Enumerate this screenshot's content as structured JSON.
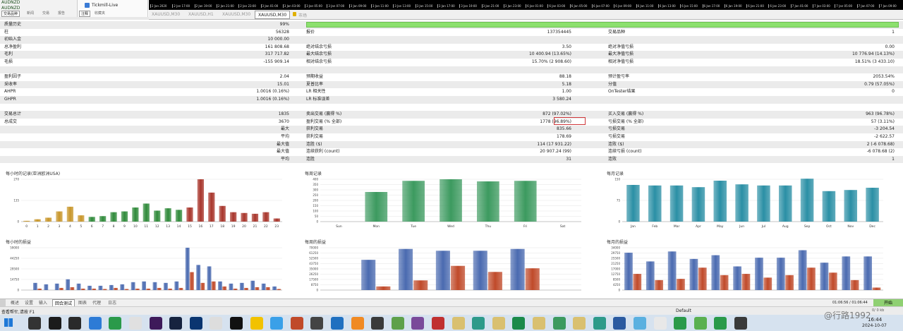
{
  "nav": {
    "account_a": "AUDNZD",
    "account_b": "AUDNZD",
    "tab_history": "交易品种",
    "tab_news": "新闻",
    "tab_trade": "交易",
    "tab_report": "报告",
    "broker": "Tickmill-Live",
    "tab_note": "注释",
    "tab_fav": "收藏夹"
  },
  "time_axis": [
    "2 Jan 2020",
    "2 Jan 17:00",
    "2 Jan 19:00",
    "2 Jan 21:00",
    "2 Jan 23:00",
    "3 Jan 01:00",
    "3 Jan 03:00",
    "3 Jan 05:00",
    "3 Jan 07:00",
    "3 Jan 09:00",
    "3 Jan 11:00",
    "3 Jan 13:00",
    "3 Jan 15:00",
    "3 Jan 17:00",
    "3 Jan 19:00",
    "3 Jan 21:00",
    "3 Jan 23:00",
    "6 Jan 01:00",
    "6 Jan 03:00",
    "6 Jan 05:00",
    "6 Jan 07:00",
    "6 Jan 09:00",
    "6 Jan 11:00",
    "6 Jan 13:00",
    "6 Jan 15:00",
    "6 Jan 17:00",
    "6 Jan 19:00",
    "6 Jan 21:00",
    "6 Jan 23:00",
    "7 Jan 01:00",
    "7 Jan 03:00",
    "7 Jan 05:00",
    "7 Jan 07:00",
    "7 Jan 09:00"
  ],
  "chart_tabs": [
    "XAUUSD,M30",
    "XAUUSD,H1",
    "XAUUSD,M30",
    "XAUUSD,M30"
  ],
  "market_tab": "市场",
  "report": {
    "rows": [
      {
        "l1": "质量历史",
        "v1": "99%",
        "l2": "",
        "v2": "",
        "l3": "",
        "v3": ""
      },
      {
        "l1": "柱",
        "v1": "56328",
        "l2": "报价",
        "v2": "137354445",
        "l3": "交易品种",
        "v3": "1"
      },
      {
        "l1": "初始入金",
        "v1": "10 000.00",
        "l2": "",
        "v2": "",
        "l3": "",
        "v3": ""
      },
      {
        "l1": "总净盈利",
        "v1": "161 808.68",
        "l2": "绝对结余亏损",
        "v2": "3.50",
        "l3": "绝对净值亏损",
        "v3": "0.00"
      },
      {
        "l1": "毛利",
        "v1": "317 717.82",
        "l2": "最大结余亏损",
        "v2": "10 400.94 (13.65%)",
        "l3": "最大净值亏损",
        "v3": "10 776.94 (14.13%)"
      },
      {
        "l1": "毛损",
        "v1": "-155 909.14",
        "l2": "相对结余亏损",
        "v2": "15.70% (2 908.60)",
        "l3": "相对净值亏损",
        "v3": "18.51% (3 433.10)"
      },
      {
        "l1": "",
        "v1": "",
        "l2": "",
        "v2": "",
        "l3": "",
        "v3": ""
      },
      {
        "l1": "盈利因子",
        "v1": "2.04",
        "l2": "预期收益",
        "v2": "88.18",
        "l3": "预计盈亏率",
        "v3": "2053.54%"
      },
      {
        "l1": "采收率",
        "v1": "15.01",
        "l2": "夏普比率",
        "v2": "5.18",
        "l3": "分值",
        "v3": "0.79 (57.05%)"
      },
      {
        "l1": "AHPR",
        "v1": "1.0016 (0.16%)",
        "l2": "LR 相关性",
        "v2": "1.00",
        "l3": "OnTester结果",
        "v3": "0"
      },
      {
        "l1": "GHPR",
        "v1": "1.0016 (0.16%)",
        "l2": "LR 标准误差",
        "v2": "3 580.24",
        "l3": "",
        "v3": ""
      },
      {
        "l1": "",
        "v1": "",
        "l2": "",
        "v2": "",
        "l3": "",
        "v3": ""
      },
      {
        "l1": "交易总计",
        "v1": "1835",
        "l2": "卖出交易 (赢得 %)",
        "v2": "872 (97.02%)",
        "l3": "买入交易 (赢得 %)",
        "v3": "963 (96.78%)"
      },
      {
        "l1": "总成交",
        "v1": "3670",
        "l2": "盈利交易 (% 全部)",
        "v2": "1778 (96.89%)",
        "l3": "亏损交易 (% 全部)",
        "v3": "57 (3.11%)"
      },
      {
        "l1": "最大",
        "v1": "",
        "l2": "获利交易",
        "v2": "835.66",
        "l3": "亏损交易",
        "v3": "-3 204.54"
      },
      {
        "l1": "平均",
        "v1": "",
        "l2": "获利交易",
        "v2": "178.69",
        "l3": "亏损交易",
        "v3": "-2 622.57"
      },
      {
        "l1": "最大值",
        "v1": "",
        "l2": "连胜 ($)",
        "v2": "114 (17 931.22)",
        "l3": "连败 ($)",
        "v3": "2 (-6 078.68)"
      },
      {
        "l1": "最大值",
        "v1": "",
        "l2": "连续获利 (count)",
        "v2": "20 907.24 (99)",
        "l3": "连续亏损 (count)",
        "v3": "-6 078.68 (2)"
      },
      {
        "l1": "平均",
        "v1": "",
        "l2": "连胜",
        "v2": "31",
        "l3": "连败",
        "v3": "1"
      }
    ]
  },
  "charts": {
    "hourly_title": "每小时的记录(亚洲欧洲USA)",
    "weekly_title": "每周记录",
    "monthly_title": "每月记录",
    "hourly_pl_title": "每小时的损益",
    "weekly_pl_title": "每周的损益",
    "monthly_pl_title": "每月的损益"
  },
  "chart_data": [
    {
      "type": "bar",
      "title": "每小时的记录(亚洲欧洲USA)",
      "categories": [
        "0",
        "1",
        "2",
        "3",
        "4",
        "5",
        "6",
        "7",
        "8",
        "9",
        "10",
        "11",
        "12",
        "13",
        "14",
        "15",
        "16",
        "17",
        "18",
        "19",
        "20",
        "21",
        "22",
        "23"
      ],
      "values": [
        5,
        15,
        25,
        65,
        95,
        40,
        30,
        35,
        60,
        65,
        90,
        115,
        70,
        85,
        75,
        90,
        270,
        185,
        100,
        60,
        55,
        50,
        60,
        20
      ],
      "ylim": [
        0,
        270
      ],
      "yticks": [
        "0",
        "135",
        "270"
      ]
    },
    {
      "type": "bar",
      "title": "每周记录",
      "categories": [
        "Sun",
        "Mon",
        "Tue",
        "Wed",
        "Thu",
        "Fri",
        "Sat"
      ],
      "values": [
        0,
        280,
        385,
        400,
        380,
        385,
        0
      ],
      "ylim": [
        0,
        400
      ],
      "yticks": [
        "0",
        "50",
        "100",
        "150",
        "200",
        "250",
        "300",
        "350",
        "400"
      ]
    },
    {
      "type": "bar",
      "title": "每月记录",
      "categories": [
        "Jan",
        "Feb",
        "Mar",
        "Apr",
        "May",
        "Jun",
        "Jul",
        "Aug",
        "Sep",
        "Oct",
        "Nov",
        "Dec"
      ],
      "values": [
        130,
        128,
        128,
        122,
        145,
        132,
        128,
        128,
        152,
        108,
        112,
        120
      ],
      "ylim": [
        0,
        150
      ],
      "yticks": [
        "0",
        "75",
        "150"
      ]
    },
    {
      "type": "bar",
      "title": "每小时的损益",
      "categories": [
        "0",
        "1",
        "2",
        "3",
        "4",
        "5",
        "6",
        "7",
        "8",
        "9",
        "10",
        "11",
        "12",
        "13",
        "14",
        "15",
        "16",
        "17",
        "18",
        "19",
        "20",
        "21",
        "22",
        "23"
      ],
      "series": [
        {
          "values": [
            0,
            10000,
            8000,
            9000,
            15000,
            9000,
            6000,
            6000,
            7000,
            8000,
            11000,
            12000,
            11000,
            10000,
            12000,
            59000,
            35000,
            33000,
            12000,
            9000,
            10000,
            13000,
            9000,
            5000
          ]
        },
        {
          "values": [
            0,
            2000,
            0,
            3000,
            4000,
            2000,
            2000,
            1500,
            3000,
            1500,
            2000,
            2000,
            3000,
            2000,
            3000,
            25000,
            10000,
            12000,
            5000,
            2000,
            3000,
            4000,
            4000,
            1500
          ]
        }
      ],
      "yticks": [
        "0",
        "14750",
        "29500",
        "44250",
        "59000"
      ]
    },
    {
      "type": "bar",
      "title": "每周的损益",
      "categories": [
        "Sun",
        "Mon",
        "Tue",
        "Wed",
        "Thu",
        "Fri",
        "Sat"
      ],
      "series": [
        {
          "values": [
            0,
            50000,
            68000,
            65000,
            65000,
            68000,
            0
          ]
        },
        {
          "values": [
            0,
            6000,
            16000,
            40000,
            30000,
            36000,
            0
          ]
        }
      ],
      "yticks": [
        "0",
        "8750",
        "17500",
        "26250",
        "35000",
        "43750",
        "52500",
        "61250",
        "70000"
      ]
    },
    {
      "type": "bar",
      "title": "每月的损益",
      "categories": [
        "Jan",
        "Feb",
        "Mar",
        "Apr",
        "May",
        "Jun",
        "Jul",
        "Aug",
        "Sep",
        "Oct",
        "Nov",
        "Dec"
      ],
      "series": [
        {
          "values": [
            30000,
            23000,
            31000,
            25000,
            28000,
            19000,
            26000,
            26000,
            32000,
            22000,
            27000,
            27000
          ]
        },
        {
          "values": [
            13000,
            8000,
            9000,
            18000,
            12000,
            13000,
            10000,
            12000,
            18000,
            14000,
            8000,
            2000
          ]
        }
      ],
      "yticks": [
        "0",
        "4250",
        "8500",
        "12750",
        "17000",
        "21250",
        "25500",
        "29750",
        "34000"
      ]
    }
  ],
  "bottom_tabs": [
    "概述",
    "设置",
    "输入",
    "回合测试",
    "图表",
    "代理",
    "日志"
  ],
  "timer": "01:06:56 / 01:06:44",
  "start_button": "开始",
  "status_left": "查看帮忙,请按 F1",
  "status_default": "Default",
  "status_num": "0/ 0 kb",
  "clock_time": "16:44",
  "clock_date": "2024-10-07",
  "watermark": "@行路1992",
  "colors": {
    "grid": "#e4e4e4",
    "green_bar": "#8ce06e",
    "hour_gold": "#c8962a",
    "hour_green": "#2f8a3a",
    "hour_red": "#a8352b",
    "week_green": "#3c9a5f",
    "month_teal": "#2a8fa5",
    "pl_blue": "#4a6ab0",
    "pl_red": "#c04a2a",
    "highlight": "#d0383a"
  }
}
